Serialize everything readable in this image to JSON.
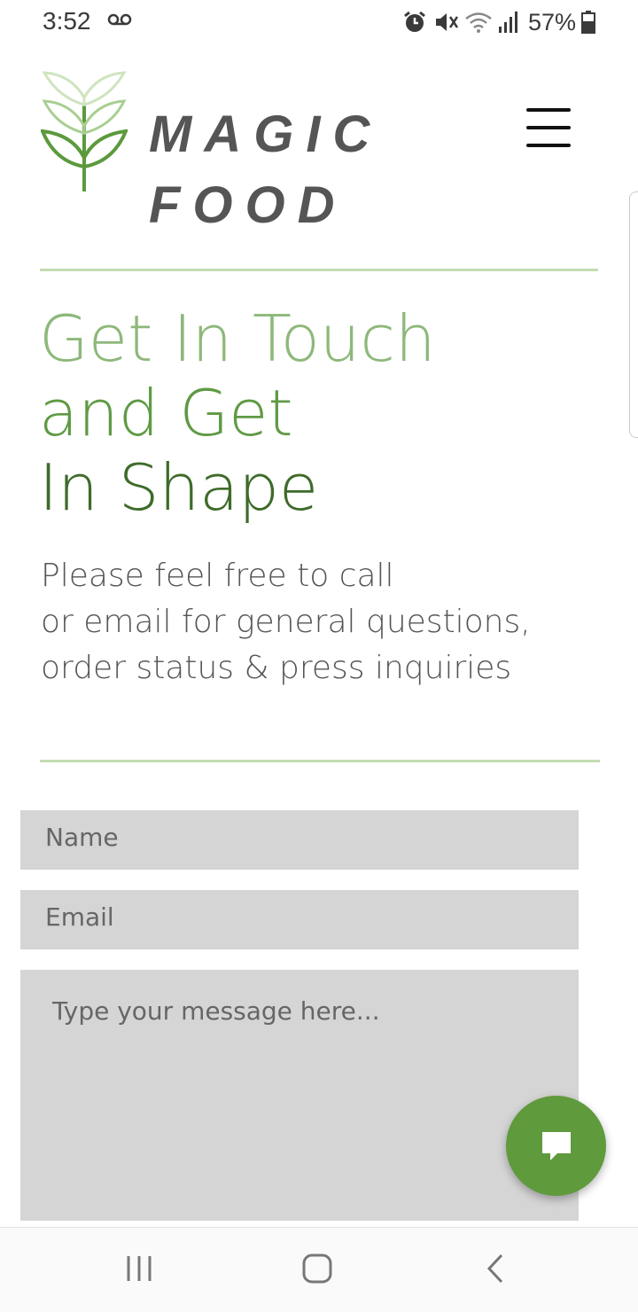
{
  "status_bar": {
    "time": "3:52",
    "battery_percent": "57%"
  },
  "header": {
    "logo_line1": "MAGIC",
    "logo_line2": "FOOD"
  },
  "hero": {
    "heading_line1": "Get In Touch",
    "heading_line2": "and Get",
    "heading_line3": "In Shape",
    "intro_line1": "Please feel free to call",
    "intro_line2": "or email for general questions,",
    "intro_line3": "order status & press inquiries"
  },
  "form": {
    "name_placeholder": "Name",
    "email_placeholder": "Email",
    "message_placeholder": "Type your message here..."
  },
  "colors": {
    "accent": "#5f9a3d",
    "heading_light": "#8db87a",
    "heading_mid": "#5f9a44",
    "heading_dark": "#3e6b2a",
    "divider": "#c3dcb0",
    "field_bg": "#d5d5d5"
  },
  "icons": {
    "status": [
      "voicemail-icon",
      "alarm-icon",
      "vibrate-icon",
      "wifi-icon",
      "signal-icon",
      "battery-icon"
    ],
    "header": [
      "leaf-logo-icon",
      "hamburger-menu-icon"
    ],
    "chat": "chat-bubble-icon",
    "nav": [
      "recent-apps-icon",
      "home-icon",
      "back-icon"
    ]
  }
}
